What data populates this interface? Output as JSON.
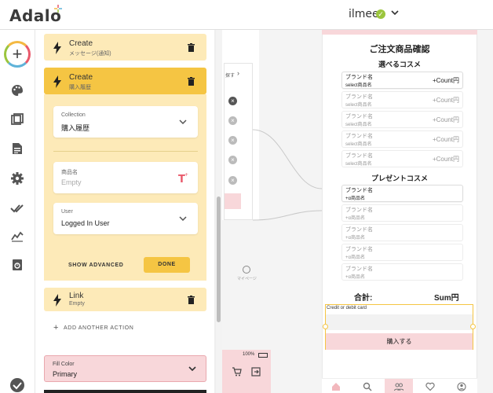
{
  "topbar": {
    "logo": "Adalo",
    "user_name": "ilmee"
  },
  "actions": [
    {
      "title": "Create",
      "subtitle": "メッセージ(通知)"
    },
    {
      "title": "Create",
      "subtitle": "購入履歴"
    },
    {
      "title": "Link",
      "subtitle": "Empty"
    }
  ],
  "action_form": {
    "collection_label": "Collection",
    "collection_value": "購入履歴",
    "product_label": "商品名",
    "product_placeholder": "Empty",
    "user_label": "User",
    "user_value": "Logged In User",
    "show_advanced": "SHOW ADVANCED",
    "done": "DONE"
  },
  "add_another_action": "ADD ANOTHER ACTION",
  "fill_color": {
    "label": "Fill Color",
    "value": "Primary"
  },
  "canvas": {
    "mini_screen_label": "探す",
    "mini_profile_label": "マイページ",
    "battery_pct": "100%"
  },
  "phone": {
    "title": "ご注文商品確認",
    "section1": "選べるコスメ",
    "selectable_rows": [
      {
        "brand": "ブランド名",
        "item": "select商品名",
        "count": "+Count円"
      },
      {
        "brand": "ブランド名",
        "item": "select商品名",
        "count": "+Count円"
      },
      {
        "brand": "ブランド名",
        "item": "select商品名",
        "count": "+Count円"
      },
      {
        "brand": "ブランド名",
        "item": "select商品名",
        "count": "+Count円"
      },
      {
        "brand": "ブランド名",
        "item": "select商品名",
        "count": "+Count円"
      }
    ],
    "section2": "プレゼントコスメ",
    "present_rows": [
      {
        "brand": "ブランド名",
        "item": "+α商品名"
      },
      {
        "brand": "ブランド名",
        "item": "+α商品名"
      },
      {
        "brand": "ブランド名",
        "item": "+α商品名"
      },
      {
        "brand": "ブランド名",
        "item": "+α商品名"
      },
      {
        "brand": "ブランド名",
        "item": "+α商品名"
      }
    ],
    "total_label": "合計:",
    "total_value": "Sum円",
    "card_label": "Credit or debit card",
    "buy_button": "購入する"
  },
  "colors": {
    "accent_yellow": "#f5c543",
    "light_yellow": "#fdeab8",
    "pink": "#f8d7da",
    "success_green": "#9bc53d"
  }
}
